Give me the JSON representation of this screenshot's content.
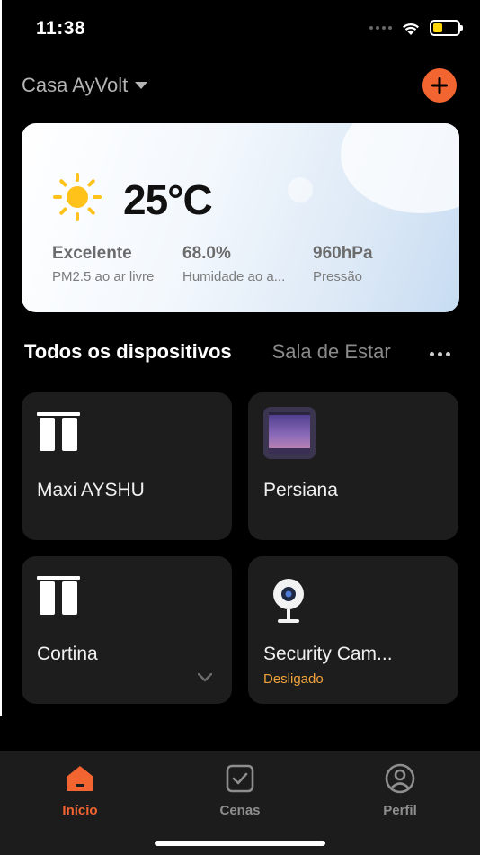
{
  "status_bar": {
    "time": "11:38"
  },
  "header": {
    "home_name": "Casa AyVolt"
  },
  "weather": {
    "temperature": "25°C",
    "metrics": [
      {
        "value": "Excelente",
        "label": "PM2.5 ao ar livre"
      },
      {
        "value": "68.0%",
        "label": "Humidade ao a..."
      },
      {
        "value": "960hPa",
        "label": "Pressão"
      }
    ]
  },
  "tabs": {
    "active": "Todos os dispositivos",
    "other": "Sala de Estar"
  },
  "devices": [
    {
      "name": "Maxi AYSHU",
      "icon": "curtain-icon",
      "status": ""
    },
    {
      "name": "Persiana",
      "icon": "blind-window-icon",
      "status": ""
    },
    {
      "name": "Cortina",
      "icon": "curtain-icon",
      "status": ""
    },
    {
      "name": "Security Cam...",
      "icon": "security-camera-icon",
      "status": "Desligado"
    }
  ],
  "tabbar": {
    "items": [
      {
        "label": "Início",
        "icon": "home-icon"
      },
      {
        "label": "Cenas",
        "icon": "checkbox-icon"
      },
      {
        "label": "Perfil",
        "icon": "profile-icon"
      }
    ]
  },
  "colors": {
    "accent": "#f26430",
    "status_off": "#f0a23b",
    "card_bg": "#1d1d1d",
    "background": "#000000"
  }
}
